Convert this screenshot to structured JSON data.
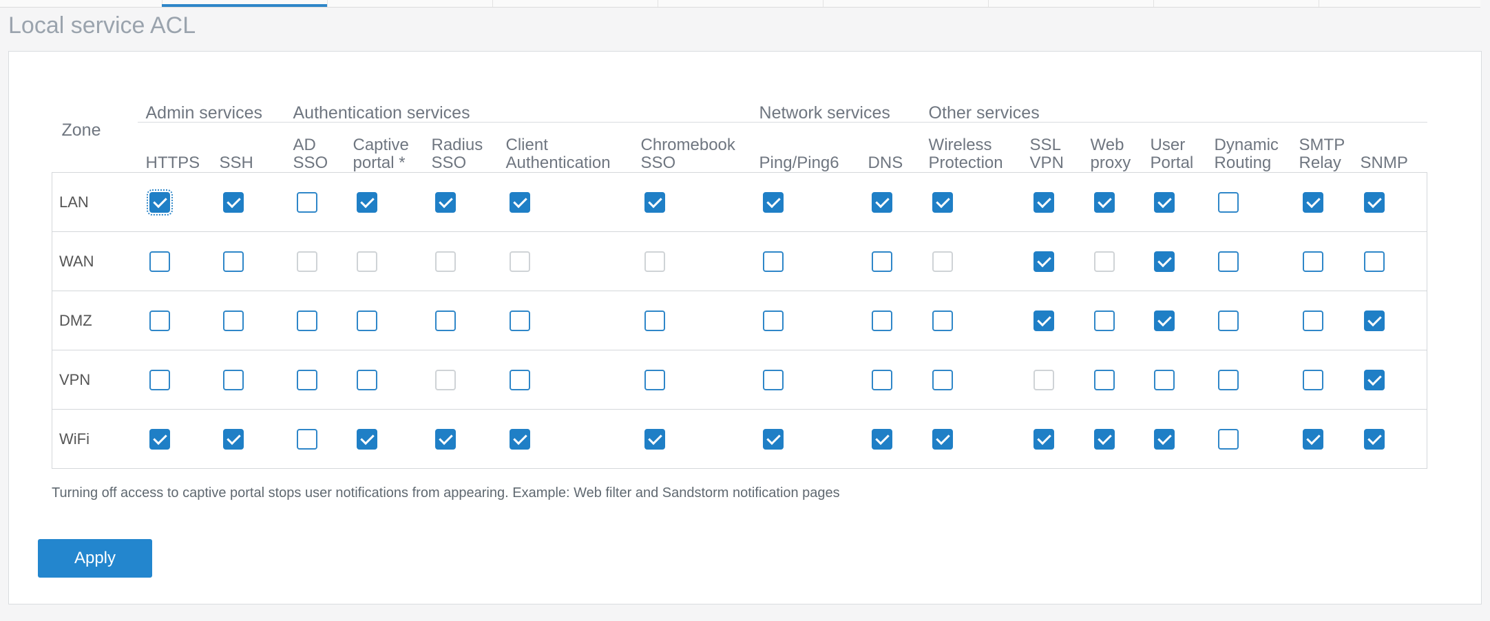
{
  "section_title": "Local service ACL",
  "zone_header": "Zone",
  "groups": [
    {
      "label": "Admin services",
      "span": 2
    },
    {
      "label": "Authentication services",
      "span": 5
    },
    {
      "label": "Network services",
      "span": 2
    },
    {
      "label": "Other services",
      "span": 7
    }
  ],
  "services": [
    [
      "HTTPS"
    ],
    [
      "SSH"
    ],
    [
      "AD",
      "SSO"
    ],
    [
      "Captive",
      "portal *"
    ],
    [
      "Radius",
      "SSO"
    ],
    [
      "Client",
      "Authentication"
    ],
    [
      "Chromebook",
      "SSO"
    ],
    [
      "Ping/Ping6"
    ],
    [
      "DNS"
    ],
    [
      "Wireless",
      "Protection"
    ],
    [
      "SSL",
      "VPN"
    ],
    [
      "Web",
      "proxy"
    ],
    [
      "User",
      "Portal"
    ],
    [
      "Dynamic",
      "Routing"
    ],
    [
      "SMTP",
      "Relay"
    ],
    [
      "SNMP"
    ]
  ],
  "rows": [
    {
      "zone": "LAN",
      "cells": [
        "c",
        "c",
        "u",
        "c",
        "c",
        "c",
        "c",
        "c",
        "c",
        "c",
        "c",
        "c",
        "c",
        "u",
        "c",
        "c"
      ]
    },
    {
      "zone": "WAN",
      "cells": [
        "u",
        "u",
        "d",
        "d",
        "d",
        "d",
        "d",
        "u",
        "u",
        "d",
        "c",
        "d",
        "c",
        "u",
        "u",
        "u"
      ]
    },
    {
      "zone": "DMZ",
      "cells": [
        "u",
        "u",
        "u",
        "u",
        "u",
        "u",
        "u",
        "u",
        "u",
        "u",
        "c",
        "u",
        "c",
        "u",
        "u",
        "c"
      ]
    },
    {
      "zone": "VPN",
      "cells": [
        "u",
        "u",
        "u",
        "u",
        "d",
        "u",
        "u",
        "u",
        "u",
        "u",
        "d",
        "u",
        "u",
        "u",
        "u",
        "c"
      ]
    },
    {
      "zone": "WiFi",
      "cells": [
        "c",
        "c",
        "u",
        "c",
        "c",
        "c",
        "c",
        "c",
        "c",
        "c",
        "c",
        "c",
        "c",
        "u",
        "c",
        "c"
      ]
    }
  ],
  "note": "Turning off access to captive portal stops user notifications from appearing. Example: Web filter and Sandstorm notification pages",
  "apply_label": "Apply",
  "colors": {
    "accent": "#2386ce",
    "disabled": "#cfd3d6"
  }
}
